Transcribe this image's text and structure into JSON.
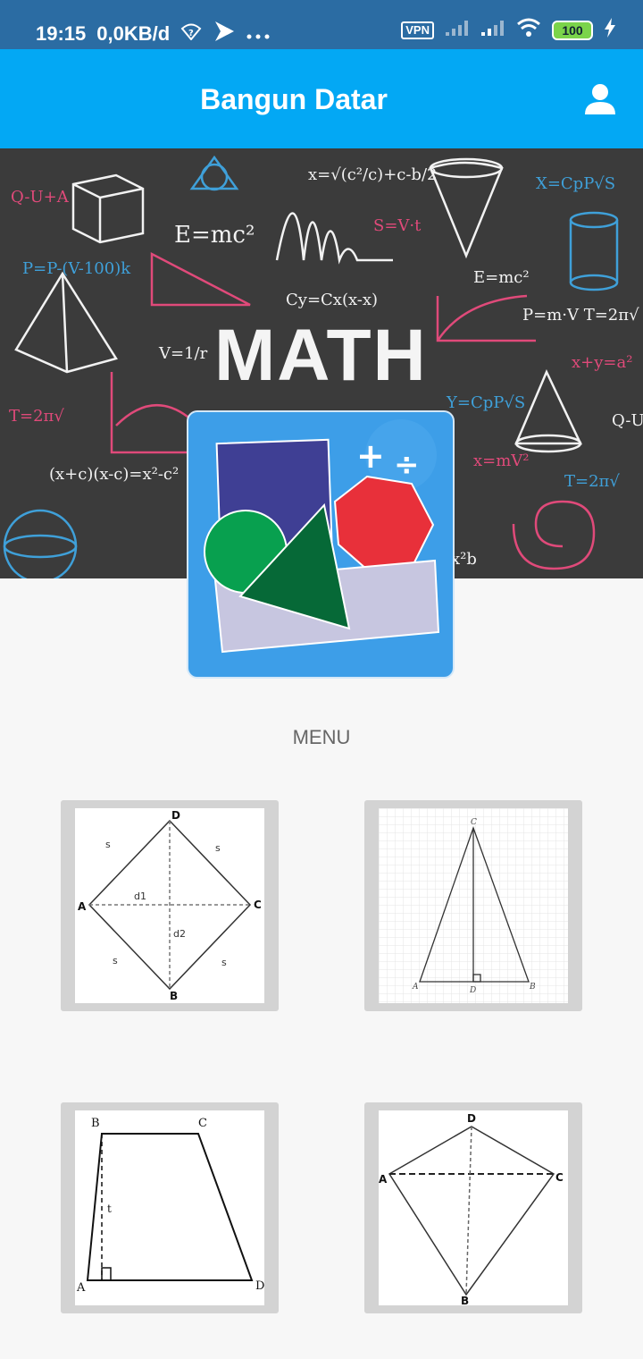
{
  "status_bar": {
    "time": "19:15",
    "network_speed": "0,0KB/d",
    "vpn": "VPN",
    "battery": "100",
    "icons": [
      "wifi-question-icon",
      "play-icon",
      "more-dots-icon",
      "vpn-icon",
      "signal-icon",
      "signal-icon",
      "wifi-icon",
      "battery-icon",
      "charging-icon"
    ]
  },
  "app_bar": {
    "title": "Bangun Datar",
    "profile_icon": "person-icon",
    "background": "#03a8f4"
  },
  "hero": {
    "headline": "MATH",
    "formulas": [
      "Q-U+A",
      "E=mc²",
      "S=V·t",
      "E=mc²",
      "P=m·V",
      "V=1/r",
      "x+y=a²",
      "Q-U",
      "T=2π√(l/g)",
      "(x+c)(x-c)=x²-c²",
      "Y=CpP√(S/S)",
      "x=mV²/2",
      "Cy=Cx(x-x)",
      "P=P-(V-100)k",
      "X=CpP√(S/S)",
      "x²b",
      "T=2π√(l/g)"
    ]
  },
  "logo": {
    "operators": [
      "+",
      "÷"
    ],
    "background": "#3d9ee8"
  },
  "menu": {
    "label": "MENU",
    "items": [
      {
        "shape": "rhombus",
        "labels": {
          "top": "D",
          "left": "A",
          "right": "C",
          "bottom": "B",
          "diag1": "d1",
          "diag2": "d2",
          "side": "s"
        }
      },
      {
        "shape": "isosceles-triangle",
        "labels": {
          "apex": "C",
          "left": "A",
          "foot": "D",
          "right": "B"
        }
      },
      {
        "shape": "trapezoid",
        "labels": {
          "top_left": "B",
          "top_right": "C",
          "bottom_left": "A",
          "bottom_right": "D",
          "height": "t"
        }
      },
      {
        "shape": "kite",
        "labels": {
          "top": "D",
          "left": "A",
          "right": "C",
          "bottom": "B"
        }
      }
    ]
  }
}
